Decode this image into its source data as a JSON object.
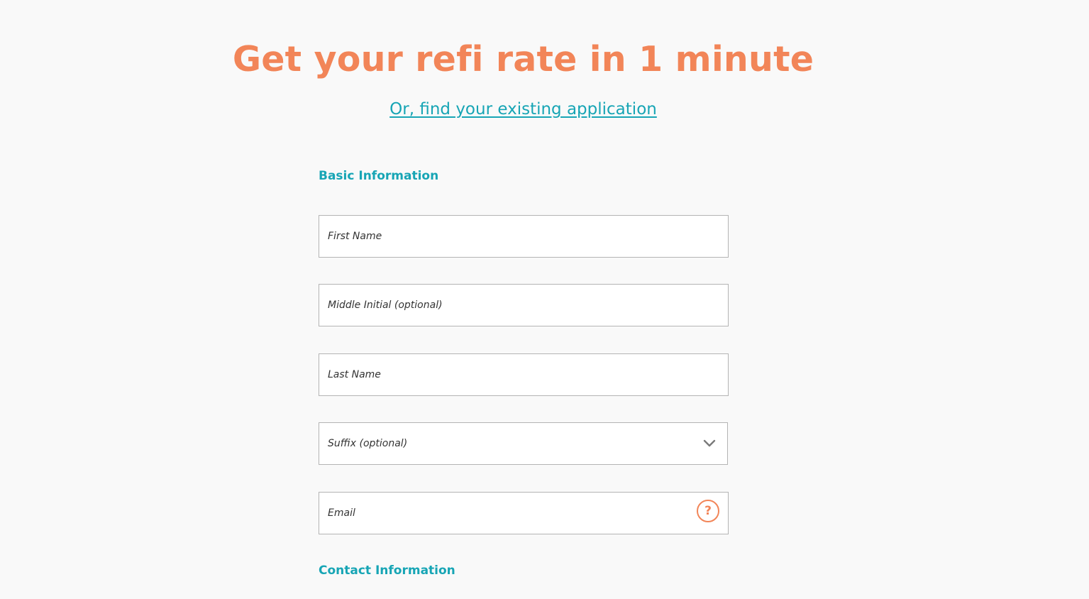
{
  "header": {
    "title": "Get your refi rate in 1 minute",
    "existing_link": "Or, find your existing application"
  },
  "basic_info": {
    "section_title": "Basic Information",
    "first_name": {
      "placeholder": "First Name",
      "value": ""
    },
    "middle_initial": {
      "placeholder": "Middle Initial (optional)",
      "value": ""
    },
    "last_name": {
      "placeholder": "Last Name",
      "value": ""
    },
    "suffix": {
      "selected": "Suffix (optional)",
      "icon": "chevron-down-icon"
    },
    "email": {
      "placeholder": "Email",
      "value": "",
      "help_icon": "?"
    }
  },
  "contact_info": {
    "section_title": "Contact Information"
  },
  "colors": {
    "accent_orange": "#f28558",
    "accent_teal": "#17a5b5",
    "background": "#f9f9f9",
    "field_border": "#b4b4b4"
  }
}
